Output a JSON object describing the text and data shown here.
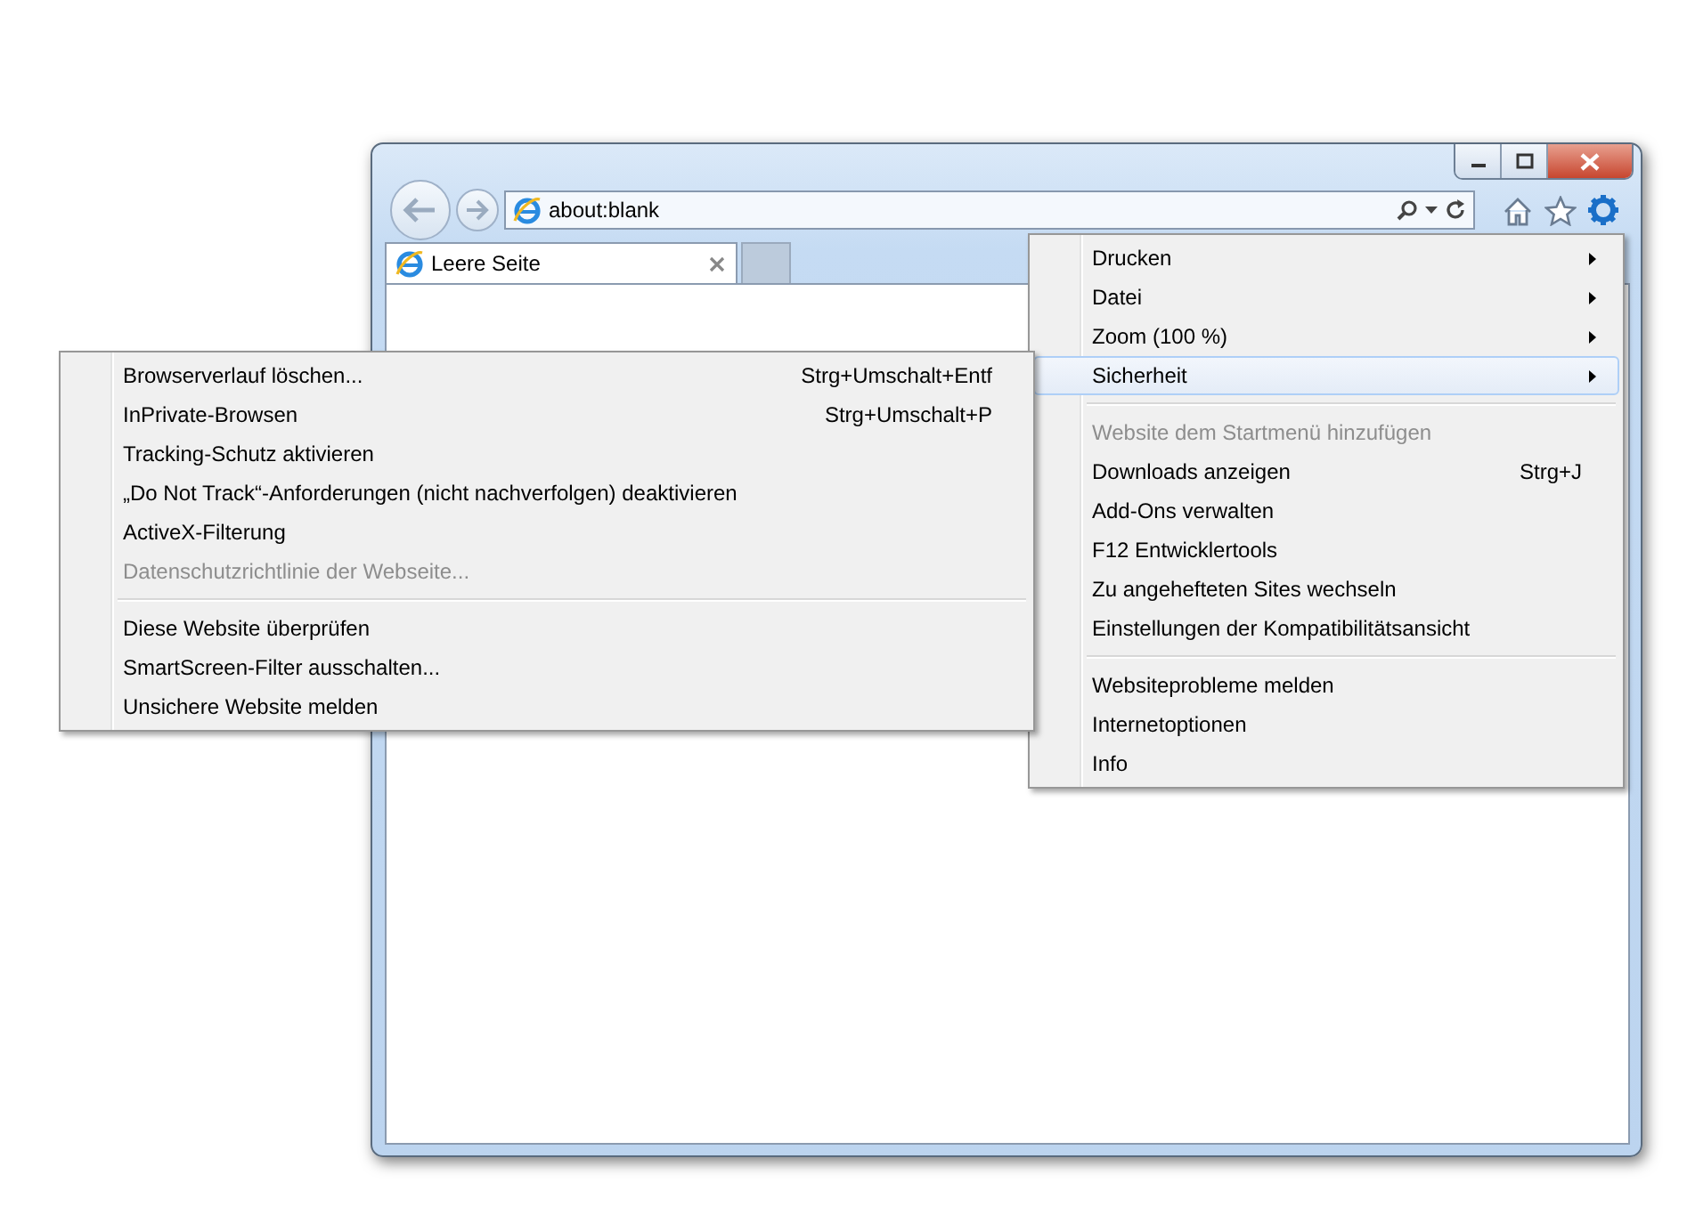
{
  "window": {
    "controls": [
      {
        "kind": "minimize"
      },
      {
        "kind": "maximize"
      },
      {
        "kind": "close"
      }
    ]
  },
  "address_bar": {
    "value": "about:blank"
  },
  "tabs": [
    {
      "label": "Leere Seite",
      "selected": true
    }
  ],
  "tools_menu": {
    "items": [
      {
        "kind": "item",
        "label": "Drucken",
        "submenu": true,
        "selected": false,
        "disabled": false
      },
      {
        "kind": "item",
        "label": "Datei",
        "submenu": true,
        "selected": false,
        "disabled": false
      },
      {
        "kind": "item",
        "label": "Zoom (100 %)",
        "submenu": true,
        "selected": false,
        "disabled": false
      },
      {
        "kind": "item",
        "label": "Sicherheit",
        "submenu": true,
        "selected": true,
        "disabled": false
      },
      {
        "kind": "separator"
      },
      {
        "kind": "item",
        "label": "Website dem Startmenü hinzufügen",
        "submenu": false,
        "selected": false,
        "disabled": true
      },
      {
        "kind": "item",
        "label": "Downloads anzeigen",
        "shortcut": "Strg+J",
        "submenu": false,
        "selected": false,
        "disabled": false
      },
      {
        "kind": "item",
        "label": "Add-Ons verwalten",
        "submenu": false,
        "selected": false,
        "disabled": false
      },
      {
        "kind": "item",
        "label": "F12 Entwicklertools",
        "submenu": false,
        "selected": false,
        "disabled": false
      },
      {
        "kind": "item",
        "label": "Zu angehefteten Sites wechseln",
        "submenu": false,
        "selected": false,
        "disabled": false
      },
      {
        "kind": "item",
        "label": "Einstellungen der Kompatibilitätsansicht",
        "submenu": false,
        "selected": false,
        "disabled": false
      },
      {
        "kind": "separator"
      },
      {
        "kind": "item",
        "label": "Websiteprobleme melden",
        "submenu": false,
        "selected": false,
        "disabled": false
      },
      {
        "kind": "item",
        "label": "Internetoptionen",
        "submenu": false,
        "selected": false,
        "disabled": false
      },
      {
        "kind": "item",
        "label": "Info",
        "submenu": false,
        "selected": false,
        "disabled": false
      }
    ]
  },
  "security_submenu": {
    "items": [
      {
        "kind": "item",
        "label": "Browserverlauf löschen...",
        "shortcut": "Strg+Umschalt+Entf",
        "disabled": false
      },
      {
        "kind": "item",
        "label": "InPrivate-Browsen",
        "shortcut": "Strg+Umschalt+P",
        "disabled": false
      },
      {
        "kind": "item",
        "label": "Tracking-Schutz aktivieren",
        "disabled": false
      },
      {
        "kind": "item",
        "label": "„Do Not Track“-Anforderungen (nicht nachverfolgen) deaktivieren",
        "disabled": false
      },
      {
        "kind": "item",
        "label": "ActiveX-Filterung",
        "disabled": false
      },
      {
        "kind": "item",
        "label": "Datenschutzrichtlinie der Webseite...",
        "disabled": true
      },
      {
        "kind": "separator"
      },
      {
        "kind": "item",
        "label": "Diese Website überprüfen",
        "disabled": false
      },
      {
        "kind": "item",
        "label": "SmartScreen-Filter ausschalten...",
        "disabled": false
      },
      {
        "kind": "item",
        "label": "Unsichere Website melden",
        "disabled": false
      }
    ]
  }
}
